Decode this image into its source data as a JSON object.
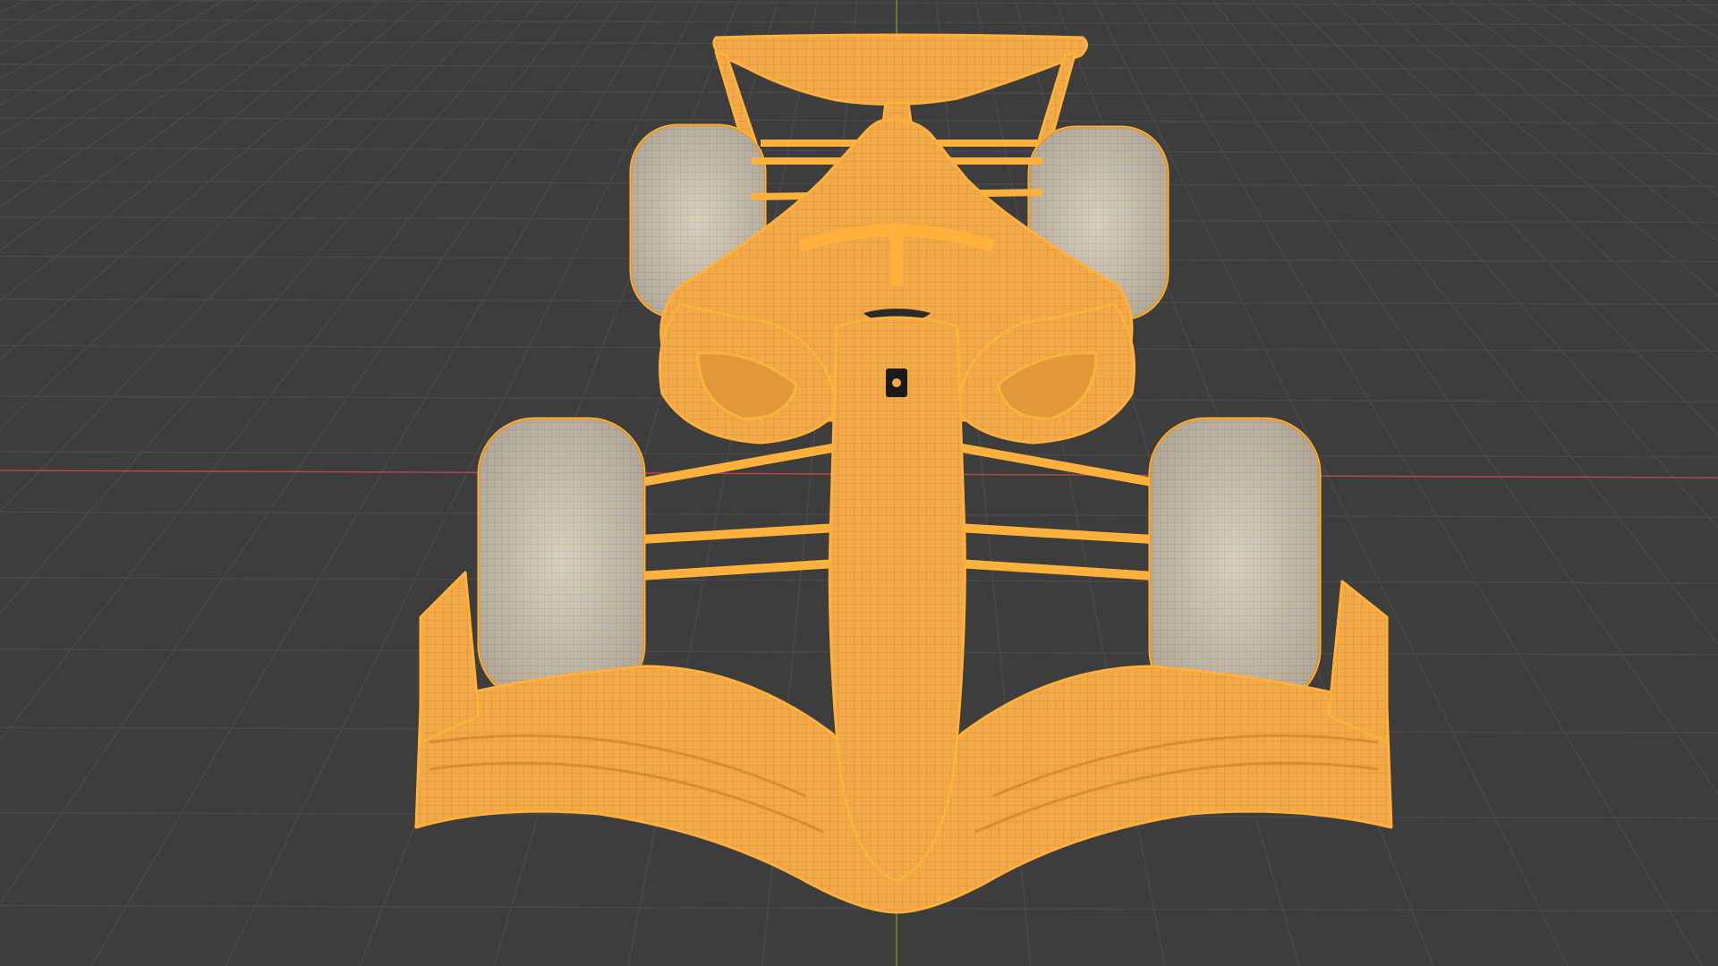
{
  "viewport": {
    "mode": "3D Viewport",
    "shading": "wireframe",
    "background_color": "#3d3d3d",
    "grid_color": "#4a4a4a",
    "x_axis_color": "#b5474b",
    "y_axis_color": "#6c8c3a",
    "selection_color": "#f3a947",
    "selection_edge_color": "#ffb13b",
    "tyre_color": "#c9c2b8"
  },
  "object": {
    "name_icon": "formula-car-icon",
    "selected": true,
    "parts": [
      "rear-wing",
      "rear-wing-endplate-left",
      "rear-wing-endplate-right",
      "rear-tyre-left",
      "rear-tyre-right",
      "engine-cover",
      "halo",
      "sidepod-left",
      "sidepod-right",
      "front-tyre-left",
      "front-tyre-right",
      "nose-cone",
      "front-suspension",
      "front-wing",
      "front-wing-endplate-left",
      "front-wing-endplate-right"
    ]
  }
}
